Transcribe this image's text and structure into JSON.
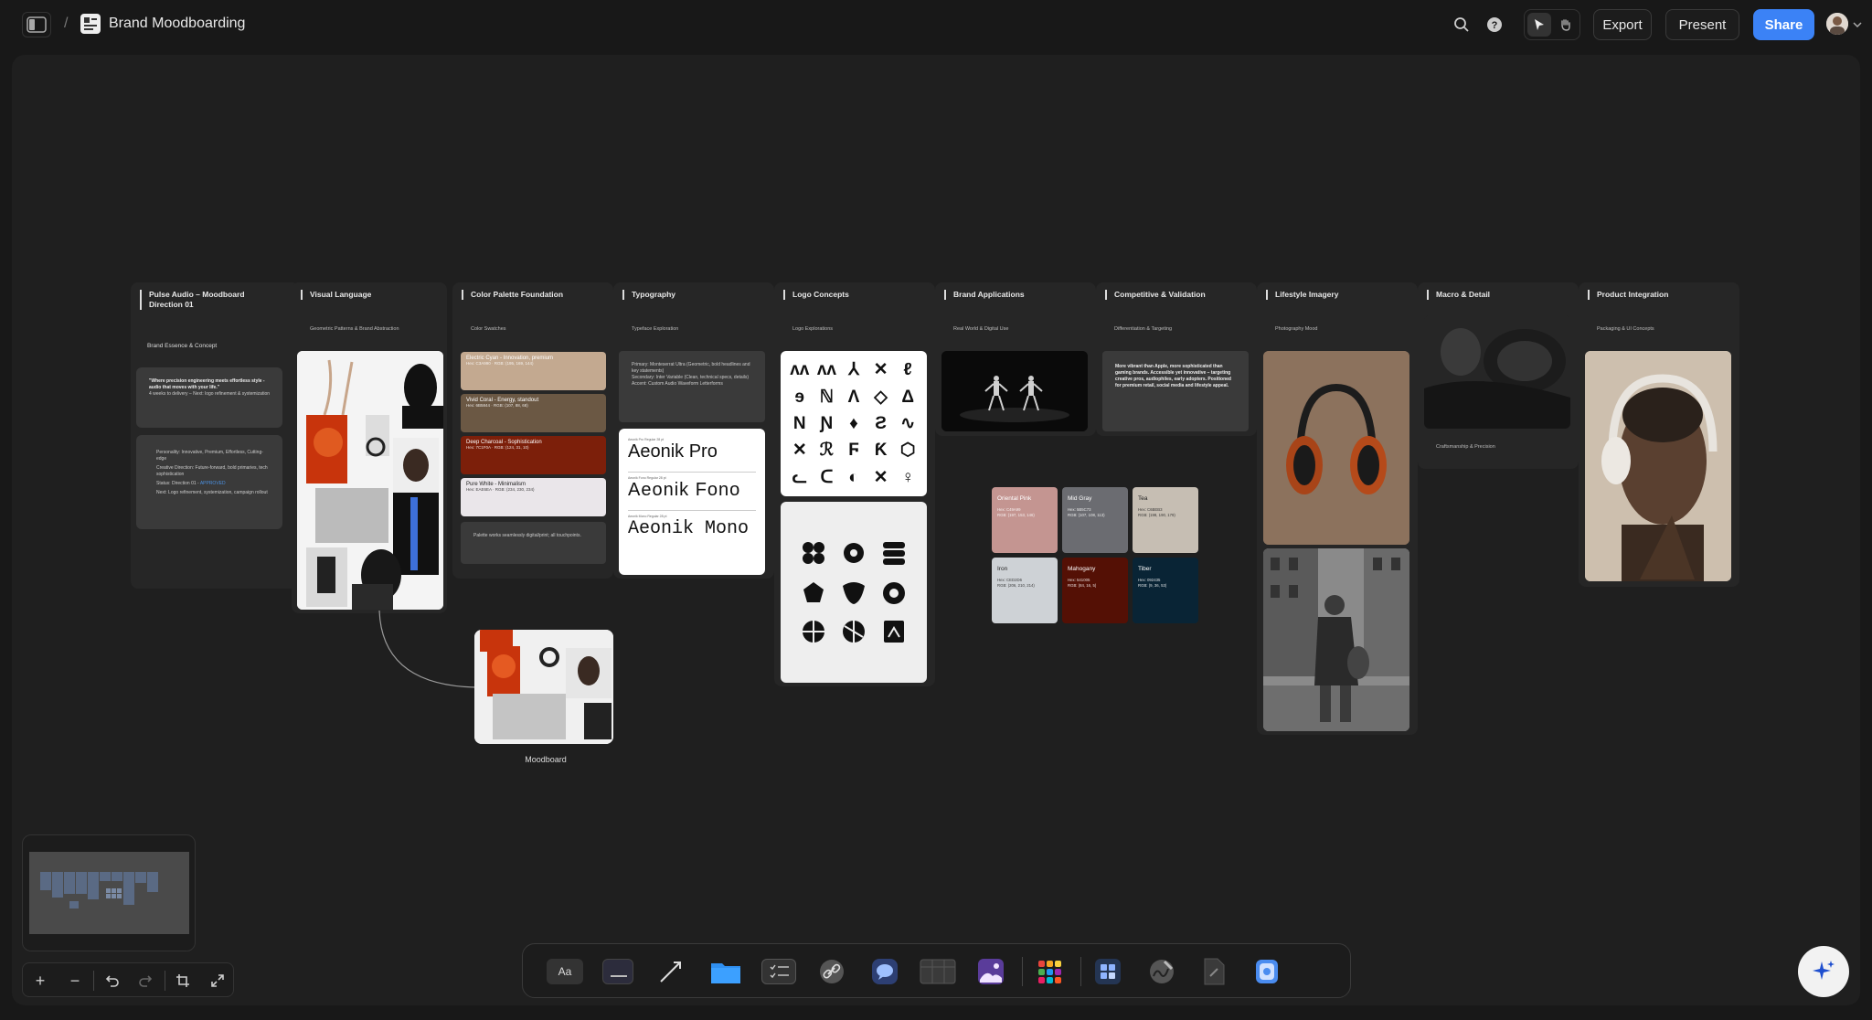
{
  "header": {
    "title": "Brand Moodboarding",
    "separator": "/",
    "export": "Export",
    "present": "Present",
    "share": "Share"
  },
  "cards": {
    "concept": {
      "title": "Pulse Audio – Moodboard Direction 01",
      "sub": "Brand Essence & Concept",
      "quote": "\"Where precision engineering meets effortless style - audio that moves with your life.\"",
      "quote2": "4 weeks to delivery – Next: logo refinement & systemization",
      "b1": "Personality: Innovative, Premium, Effortless, Cutting-edge",
      "b2": "Creative Direction: Future-forward, bold primaries, tech sophistication",
      "b3": "Status: Direction 01 - ",
      "b3s": "APPROVED",
      "b4": "Next: Logo refinement, systemization, campaign rollout"
    },
    "visual": {
      "title": "Visual Language",
      "sub": "Geometric Patterns & Brand Abstraction"
    },
    "palette": {
      "title": "Color Palette Foundation",
      "sub": "Color Swatches",
      "s1": "Electric Cyan - Innovation, premium",
      "s1m": "Hex: C3A990 · RGB: (195, 169, 144)",
      "s2": "Vivid Coral - Energy, standout",
      "s2m": "Hex: 6B5844 · RGB: (107, 88, 68)",
      "s3": "Deep Charcoal - Sophistication",
      "s3m": "Hex: 7C1F0A · RGB: (124, 31, 10)",
      "s4": "Pure White - Minimalism",
      "s4m": "Hex: EAE6EA · RGB: (234, 230, 234)",
      "note": "Palette works seamlessly digital/print; all touchpoints."
    },
    "type": {
      "title": "Typography",
      "sub": "Typeface Exploration",
      "p": "Primary: Monteserrat Ultra (Geometric, bold headlines and key statements)",
      "s": "Secondary: Inter Variable (Clean, technical specs, details)",
      "a": "Accent: Custom Audio Waveform Letterforms",
      "f1": "Aeonik Pro",
      "f2": "Aeonik Fono",
      "f3": "Aeonik Mono",
      "f1c": "Aeonik Pro Regular 28 pt",
      "f2c": "Aeonik Fono Regular 28 pt",
      "f3c": "Aeonik Mono Regular 28 pt"
    },
    "logo": {
      "title": "Logo Concepts",
      "sub": "Logo Explorations"
    },
    "brand": {
      "title": "Brand Applications",
      "sub": "Real World & Digital Use"
    },
    "comp": {
      "title": "Competitive & Validation",
      "sub": "Differentiation & Targeting",
      "text": "More vibrant than Apple, more sophisticated than gaming brands. Accessible yet innovative – targeting creative pros, audiophiles, early adopters. Positioned for premium retail, social media and lifestyle appeal."
    },
    "life": {
      "title": "Lifestyle Imagery",
      "sub": "Photography Mood"
    },
    "macro": {
      "title": "Macro & Detail",
      "sub": "Craftsmanship & Precision"
    },
    "product": {
      "title": "Product Integration",
      "sub": "Packaging & UI Concepts"
    }
  },
  "swatches": [
    {
      "name": "Oriental Pink",
      "hex": "Hex: C49A99",
      "rgb": "RGB: (197, 153, 146)",
      "color": "#c49591"
    },
    {
      "name": "Mid Gray",
      "hex": "Hex: 5B5C73",
      "rgb": "RGB: (107, 108, 113)",
      "color": "#6b6c71"
    },
    {
      "name": "Tea",
      "hex": "Hex: C6BEB3",
      "rgb": "RGB: (198, 190, 179)",
      "color": "#c6beb3"
    },
    {
      "name": "Iron",
      "hex": "Hex: CED2D6",
      "rgb": "RGB: (206, 210, 214)",
      "color": "#ced2d6"
    },
    {
      "name": "Mahogany",
      "hex": "Hex: 541005",
      "rgb": "RGB: (84, 16, 5)",
      "color": "#541005"
    },
    {
      "name": "Tiber",
      "hex": "Hex: 092435",
      "rgb": "RGB: (9, 36, 53)",
      "color": "#092435"
    }
  ],
  "moodboard": {
    "label": "Moodboard"
  },
  "dock": {
    "text_tool": "Aa"
  },
  "logo_glyphs": [
    "ʌʌ",
    "ʌʌ",
    "⅄",
    "✕",
    "ℓ",
    "ɘ",
    "ℕ",
    "Ʌ",
    "◇",
    "Δ",
    "Ν",
    "Ɲ",
    "♦",
    "Ƨ",
    "∿",
    "✕",
    "ℛ",
    "Ϝ",
    "Ƙ",
    "⬡",
    "ᓚ",
    "ᑕ",
    "◐",
    "✕",
    "♀"
  ],
  "colors": {
    "accent": "#3b82f6",
    "status_approved": "#4a90e2"
  }
}
